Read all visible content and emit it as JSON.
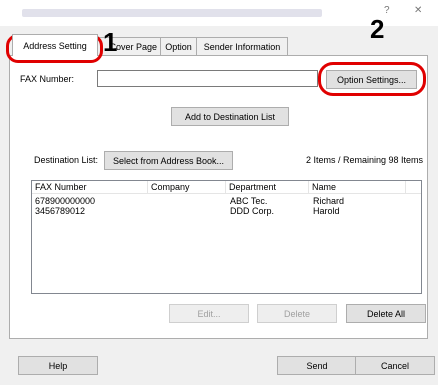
{
  "window": {
    "controls": {
      "help": "?",
      "close": "✕"
    }
  },
  "tabs": [
    {
      "label": "Address Setting"
    },
    {
      "label": "Cover Page"
    },
    {
      "label": "Option"
    },
    {
      "label": "Sender Information"
    }
  ],
  "fax": {
    "label": "FAX Number:",
    "value": "",
    "option_button": "Option Settings...",
    "add_button": "Add to Destination List"
  },
  "destinations": {
    "label": "Destination List:",
    "select_button": "Select from Address Book...",
    "status": "2 Items / Remaining 98 Items",
    "columns": [
      "FAX Number",
      "Company",
      "Department",
      "Name"
    ],
    "rows": [
      [
        "678900000000",
        "",
        "ABC Tec.",
        "Richard"
      ],
      [
        "3456789012",
        "",
        "DDD Corp.",
        "Harold"
      ]
    ],
    "edit_button": "Edit...",
    "delete_button": "Delete",
    "delete_all_button": "Delete All"
  },
  "footer": {
    "help": "Help",
    "send": "Send",
    "cancel": "Cancel"
  },
  "callouts": {
    "one": "1",
    "two": "2"
  },
  "colors": {
    "callout_ring": "#e00000"
  }
}
